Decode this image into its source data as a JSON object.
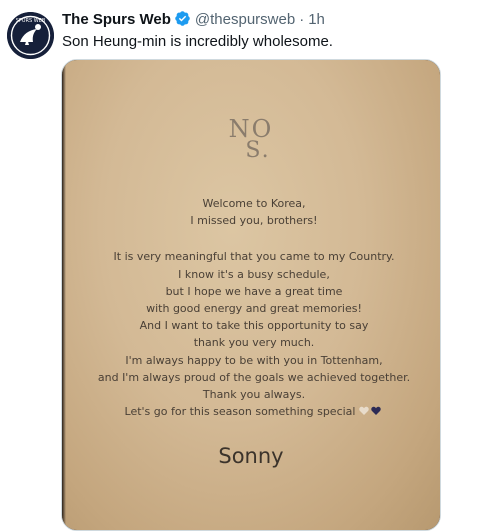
{
  "tweet": {
    "display_name": "The Spurs Web",
    "handle": "@thespursweb",
    "separator": "·",
    "time": "1h",
    "text": "Son Heung-min is incredibly wholesome."
  },
  "avatar": {
    "text": "SPURS WEB"
  },
  "media": {
    "logo_line1": "NO",
    "logo_line2": "S.",
    "letter_lines": [
      "Welcome to Korea,",
      "I missed you, brothers!",
      "",
      "It is very meaningful that you came to my Country.",
      "I know it's a busy schedule,",
      "but I hope we have a great time",
      "with good energy and great memories!",
      "And I want to take this opportunity to say",
      "thank you very much.",
      "I'm always happy to be with you in Tottenham,",
      "and I'm always proud of the goals we achieved together.",
      "Thank you always.",
      "Let's go for this season something special"
    ],
    "signature": "Sonny"
  },
  "colors": {
    "verified": "#1d9bf0",
    "card": "#d3b995",
    "muted_text": "#536471",
    "heart_white": "#e8dccb",
    "heart_navy": "#2b2a55"
  }
}
